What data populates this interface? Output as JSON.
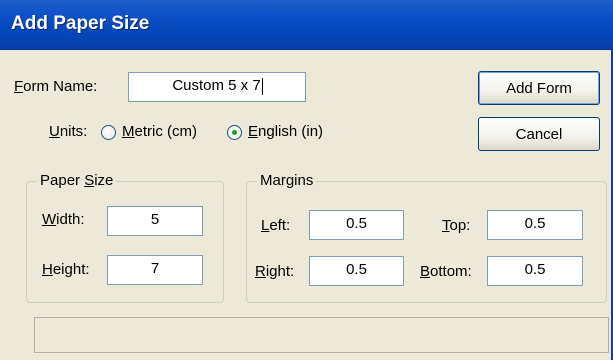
{
  "window": {
    "title": "Add Paper Size"
  },
  "form_name": {
    "label_accel": "F",
    "label_rest": "orm Name:",
    "value": "Custom 5 x 7"
  },
  "units": {
    "label_accel": "U",
    "label_rest": "nits:",
    "options": [
      {
        "accel": "M",
        "rest": "etric (cm)",
        "selected": false
      },
      {
        "accel": "E",
        "rest": "nglish (in)",
        "selected": true
      }
    ]
  },
  "buttons": {
    "add_form": "Add Form",
    "cancel": "Cancel"
  },
  "paper_size": {
    "legend_pre": "Paper ",
    "legend_accel": "S",
    "legend_rest": "ize",
    "width": {
      "accel": "W",
      "rest": "idth:",
      "value": "5"
    },
    "height": {
      "accel": "H",
      "rest": "eight:",
      "value": "7"
    }
  },
  "margins": {
    "legend": "Margins",
    "left": {
      "accel": "L",
      "rest": "eft:",
      "value": "0.5"
    },
    "right": {
      "accel": "R",
      "rest": "ight:",
      "value": "0.5"
    },
    "top": {
      "accel": "T",
      "rest": "op:",
      "value": "0.5"
    },
    "bottom": {
      "accel": "B",
      "rest": "ottom:",
      "value": "0.5"
    }
  },
  "status": {
    "text": ""
  }
}
